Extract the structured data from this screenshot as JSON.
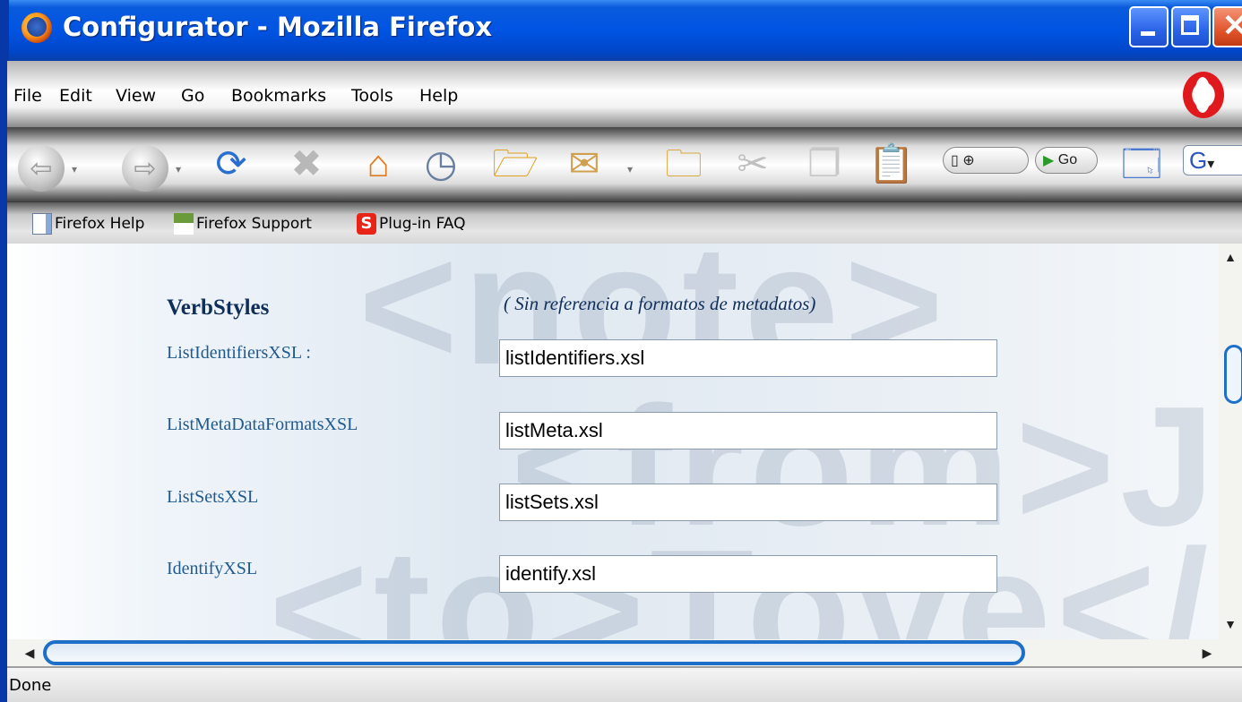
{
  "window": {
    "title": "Configurator - Mozilla Firefox",
    "controls": {
      "minimize": "minimize-icon",
      "maximize": "maximize-icon",
      "close": "close-icon"
    }
  },
  "menubar": {
    "items": [
      {
        "label": "File",
        "key": "F"
      },
      {
        "label": "Edit",
        "key": "E"
      },
      {
        "label": "View",
        "key": "V"
      },
      {
        "label": "Go",
        "key": "G"
      },
      {
        "label": "Bookmarks",
        "key": "B"
      },
      {
        "label": "Tools",
        "key": "T"
      },
      {
        "label": "Help",
        "key": "H"
      }
    ]
  },
  "toolbar": {
    "go_label": "Go",
    "search_engine_letter": "G"
  },
  "bookmarks": {
    "items": [
      {
        "label": "Firefox Help",
        "icon": "page-icon"
      },
      {
        "label": "Firefox Support",
        "icon": "zine-icon"
      },
      {
        "label": "Plug-in FAQ",
        "icon": "plugin-icon"
      }
    ]
  },
  "form": {
    "heading": "VerbStyles",
    "note": "( Sin referencia a formatos de metadatos)",
    "fields": [
      {
        "label": "ListIdentifiersXSL :",
        "value": "listIdentifiers.xsl"
      },
      {
        "label": "ListMetaDataFormatsXSL",
        "value": "listMeta.xsl"
      },
      {
        "label": "ListSetsXSL",
        "value": "listSets.xsl"
      },
      {
        "label": "IdentifyXSL",
        "value": "identify.xsl"
      }
    ]
  },
  "status": {
    "text": "Done"
  },
  "colors": {
    "titlebar": "#0054e3",
    "label": "#1f5a8f",
    "heading": "#102e5a",
    "scroll_accent": "#1e6fc8"
  }
}
